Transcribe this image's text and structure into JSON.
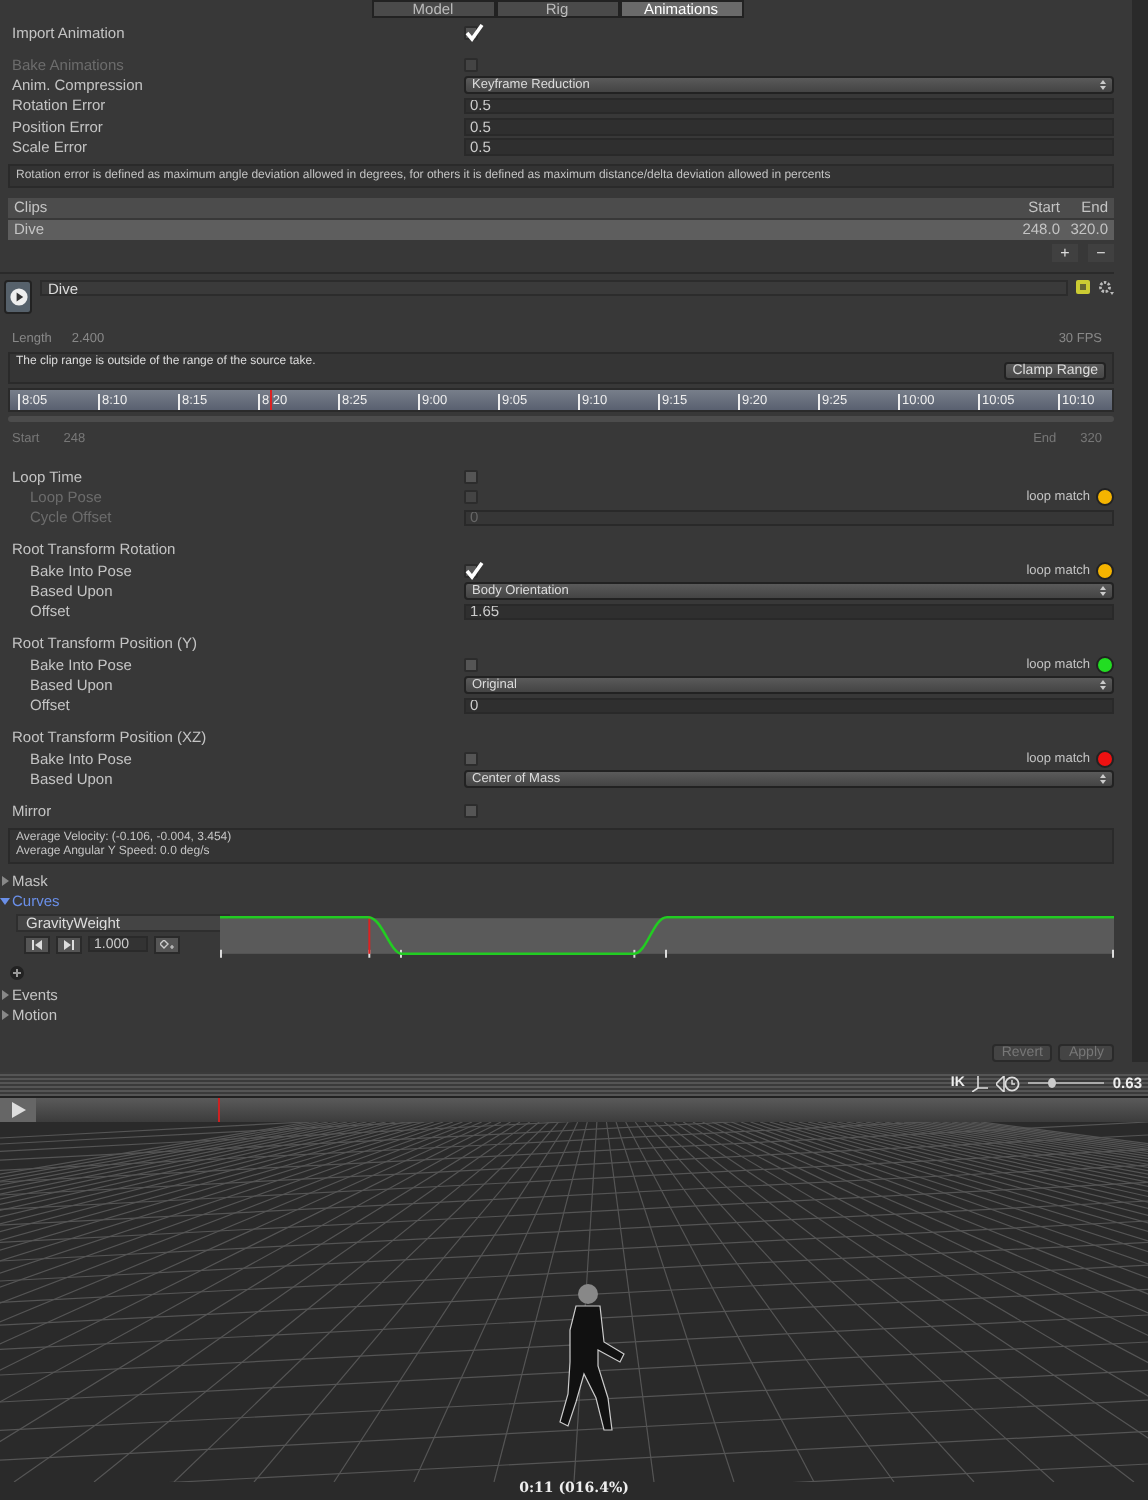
{
  "tabs": [
    {
      "label": "Model",
      "selected": false
    },
    {
      "label": "Rig",
      "selected": false
    },
    {
      "label": "Animations",
      "selected": true
    }
  ],
  "import_settings": [
    {
      "kind": "checkbox",
      "label": "Import Animation",
      "checked": true,
      "disabled": false
    },
    {
      "kind": "checkbox",
      "label": "Bake Animations",
      "checked": false,
      "disabled": true
    },
    {
      "kind": "dropdown",
      "label": "Anim. Compression",
      "value": "Keyframe Reduction",
      "disabled": false
    },
    {
      "kind": "field",
      "label": "Rotation Error",
      "value": "0.5",
      "disabled": false
    },
    {
      "kind": "field",
      "label": "Position Error",
      "value": "0.5",
      "disabled": false
    },
    {
      "kind": "field",
      "label": "Scale Error",
      "value": "0.5",
      "disabled": false
    }
  ],
  "help_text": "Rotation error is defined as maximum angle deviation allowed in degrees, for others it is defined as maximum distance/delta deviation allowed in percents",
  "clips_table": {
    "columns": [
      "Clips",
      "Start",
      "End"
    ],
    "rows": [
      {
        "name": "Dive",
        "start": "248.0",
        "end": "320.0",
        "selected": true
      }
    ],
    "add_button": "+",
    "remove_button": "−"
  },
  "clip": {
    "name": "Dive",
    "length_label": "Length",
    "length": "2.400",
    "fps": "30 FPS",
    "warning": "The clip range is outside of the range of the source take.",
    "clamp_button": "Clamp Range",
    "ruler_labels": [
      "8:05",
      "8:10",
      "8:15",
      "8:20",
      "8:25",
      "9:00",
      "9:05",
      "9:10",
      "9:15",
      "9:20",
      "9:25",
      "10:00",
      "10:05",
      "10:10"
    ],
    "start_label": "Start",
    "start": "248",
    "end_label": "End",
    "end": "320"
  },
  "clip_settings": [
    {
      "kind": "checkbox",
      "label": "Loop Time",
      "checked": false,
      "disabled": false,
      "children": [
        {
          "kind": "checkbox",
          "label": "Loop Pose",
          "checked": false,
          "disabled": true,
          "match_label": "loop match",
          "color": "#f5b400"
        },
        {
          "kind": "field",
          "label": "Cycle Offset",
          "value": "0",
          "disabled": true
        }
      ]
    },
    {
      "kind": "header",
      "label": "Root Transform Rotation",
      "children": [
        {
          "kind": "checkbox",
          "label": "Bake Into Pose",
          "checked": true,
          "disabled": false,
          "match_label": "loop match",
          "color": "#f5b400"
        },
        {
          "kind": "dropdown",
          "label": "Based Upon",
          "value": "Body Orientation",
          "disabled": false
        },
        {
          "kind": "field",
          "label": "Offset",
          "value": "1.65",
          "disabled": false
        }
      ]
    },
    {
      "kind": "header",
      "label": "Root Transform Position (Y)",
      "children": [
        {
          "kind": "checkbox",
          "label": "Bake Into Pose",
          "checked": false,
          "disabled": false,
          "match_label": "loop match",
          "color": "#22dd22"
        },
        {
          "kind": "dropdown",
          "label": "Based Upon",
          "value": "Original",
          "disabled": false
        },
        {
          "kind": "field",
          "label": "Offset",
          "value": "0",
          "disabled": false
        }
      ]
    },
    {
      "kind": "header",
      "label": "Root Transform Position (XZ)",
      "children": [
        {
          "kind": "checkbox",
          "label": "Bake Into Pose",
          "checked": false,
          "disabled": false,
          "match_label": "loop match",
          "color": "#ee1111"
        },
        {
          "kind": "dropdown",
          "label": "Based Upon",
          "value": "Center of Mass",
          "disabled": false
        }
      ]
    },
    {
      "kind": "checkbox",
      "label": "Mirror",
      "checked": false,
      "disabled": false
    }
  ],
  "motion_info": [
    "Average Velocity: (-0.106, -0.004, 3.454)",
    "Average Angular Y Speed: 0.0 deg/s"
  ],
  "foldouts": [
    {
      "label": "Mask",
      "expanded": false
    },
    {
      "label": "Curves",
      "expanded": true,
      "curves": [
        {
          "name": "GravityWeight",
          "value": "1.000"
        }
      ]
    },
    {
      "label": "Events",
      "expanded": false
    },
    {
      "label": "Motion",
      "expanded": false
    }
  ],
  "buttons": [
    {
      "label": "Revert",
      "disabled": true
    },
    {
      "label": "Apply",
      "disabled": true
    }
  ],
  "preview": {
    "ik": "IK",
    "speed_slider": {
      "level": 0.3
    },
    "speed": "0.63",
    "time_label": "0:11 (016.4%)"
  }
}
